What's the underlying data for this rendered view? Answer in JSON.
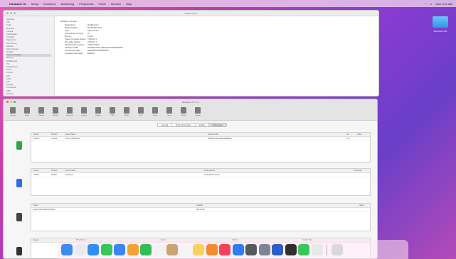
{
  "menubar": {
    "app": "Hardware IO",
    "items": [
      "Setup",
      "Interfaces",
      "Monitoring",
      "Peripherals",
      "Panel",
      "Window",
      "Help"
    ],
    "status": [
      "Mon 9:41 AM"
    ]
  },
  "desktop": {
    "item_label": "Macintosh HD"
  },
  "system_info": {
    "title": "MacBook Pro",
    "sidebar": [
      "Hardware",
      "ATA",
      "Audio",
      "Bluetooth",
      "Camera",
      "Card Reader",
      "Controller",
      "Diagnostics",
      "Disc Burning",
      "Ethernet",
      "Fibre Channel",
      "FireWire",
      "Graphics/Displays",
      "Memory",
      "NVMExpress",
      "PCI",
      "Parallel SCSI",
      "Power",
      "Printers",
      "SAS",
      "SATA",
      "SPI",
      "Storage",
      "Thunderbolt",
      "USB",
      "Network",
      "Software"
    ],
    "selected_index": 12,
    "heading": "Hardware Overview:",
    "rows": [
      [
        "Model Name:",
        "MacBook Pro"
      ],
      [
        "Model Identifier:",
        "MacBookPro18,3"
      ],
      [
        "Chip:",
        "Apple M1 Pro"
      ],
      [
        "Total Number of Cores:",
        "10"
      ],
      [
        "Memory:",
        "16 GB"
      ],
      [
        "System Firmware Version:",
        "7459.141.1"
      ],
      [
        "OS Loader Version:",
        "7459.141.1"
      ],
      [
        "Serial Number (system):",
        "C02XXXXXXX"
      ],
      [
        "Hardware UUID:",
        "00000000-0000-0000-0000-000000000000"
      ],
      [
        "Provisioning UDID:",
        "00000000-000000000000"
      ],
      [
        "Activation Lock Status:",
        "Enabled"
      ]
    ]
  },
  "hardware_io": {
    "title": "Hardware IO v1.0",
    "toolbar": [
      "General",
      "Audio",
      "Display",
      "Network",
      "Bluetooth",
      "Camera",
      "Printers",
      "USB",
      "Video",
      "Disk",
      "Power",
      "Input",
      "Battery",
      "Storage"
    ],
    "tabs": [
      "General",
      "Device Information",
      "Details",
      "Preferences"
    ],
    "active_tab": 3,
    "usb": {
      "headers": [
        "Vendor",
        "Product",
        "Device Name",
        "Serial Number",
        "Ver",
        "Active"
      ],
      "rows": [
        [
          "0x05AC",
          "0x12A8",
          "iPhone USB Device",
          "00008030-001A19E22E88802E",
          "2.00",
          ""
        ]
      ]
    },
    "bluetooth": {
      "headers": [
        "Vendor",
        "Product",
        "Device Name",
        "Serial Number",
        "Connected"
      ],
      "rows": [
        [
          "0x004C",
          "0x0267",
          "Keyboard",
          "F0-18-98-XX-XX-XX",
          ""
        ]
      ]
    },
    "storage": {
      "headers": [
        "Name",
        "Capacity",
        "Status"
      ],
      "rows": [
        [
          "Apple SSD AP0512R Media",
          "500.28 GB",
          ""
        ]
      ]
    },
    "audio": {
      "headers": [
        "Device",
        "Manufacturer",
        "Inputs",
        "Outputs",
        "Sample Rate"
      ]
    }
  },
  "dock": {
    "apps": [
      {
        "name": "Finder",
        "color": "#3d8cf0"
      },
      {
        "name": "Launchpad",
        "color": "#e9e9f1"
      },
      {
        "name": "Safari",
        "color": "#2f8ff3"
      },
      {
        "name": "Messages",
        "color": "#34c759"
      },
      {
        "name": "Mail",
        "color": "#3a86f4"
      },
      {
        "name": "Photos",
        "color": "#f4a236"
      },
      {
        "name": "FaceTime",
        "color": "#2fbf54"
      },
      {
        "name": "Calendar",
        "color": "#f2f2f2"
      },
      {
        "name": "Finder Folder",
        "color": "#c7a470"
      },
      {
        "name": "Reminders",
        "color": "#f5f5f5"
      },
      {
        "name": "Notes",
        "color": "#f7d35e"
      },
      {
        "name": "Pages",
        "color": "#f28b2e"
      },
      {
        "name": "Music",
        "color": "#f5405d"
      },
      {
        "name": "App Store",
        "color": "#2f7df4"
      },
      {
        "name": "Disk Utility",
        "color": "#555a60"
      },
      {
        "name": "System Settings",
        "color": "#7c8591"
      },
      {
        "name": "Xcode",
        "color": "#2d5ec6"
      },
      {
        "name": "Terminal",
        "color": "#2f2f2f"
      },
      {
        "name": "WhatsApp",
        "color": "#37c75a"
      },
      {
        "name": "Script Editor",
        "color": "#e8e8e8"
      }
    ],
    "trash": {
      "name": "Trash",
      "color": "#d8d8de"
    }
  }
}
